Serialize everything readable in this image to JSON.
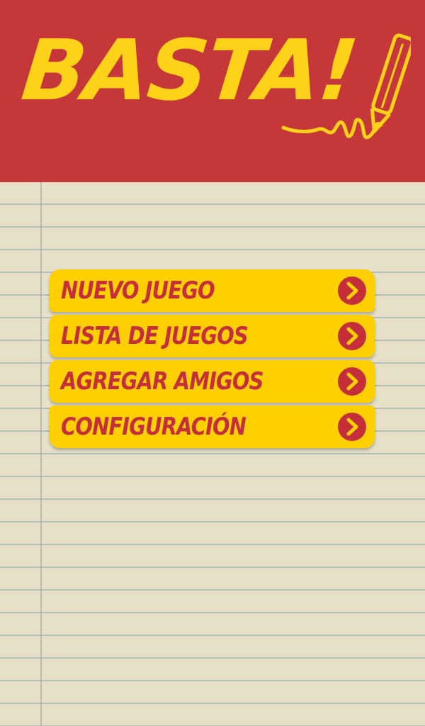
{
  "app": {
    "logo_text": "BASTA!"
  },
  "menu": {
    "items": [
      {
        "label": "NUEVO JUEGO",
        "icon": "chevron-right-icon"
      },
      {
        "label": "LISTA DE JUEGOS",
        "icon": "chevron-right-icon"
      },
      {
        "label": "AGREGAR AMIGOS",
        "icon": "chevron-right-icon"
      },
      {
        "label": "CONFIGURACIÓN",
        "icon": "chevron-right-icon"
      }
    ]
  },
  "colors": {
    "header_red": "#c6373a",
    "accent_yellow": "#ffcf00",
    "text_red": "#c42f3a",
    "paper": "#e6e0c9"
  }
}
